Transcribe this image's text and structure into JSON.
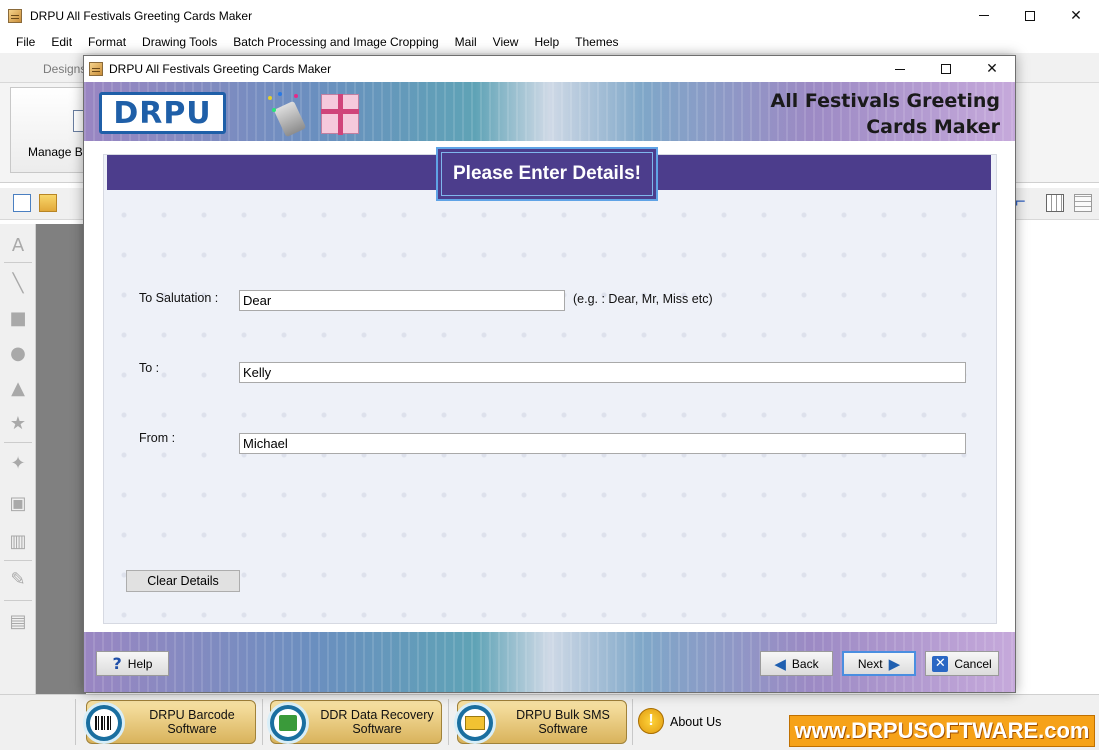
{
  "main_window": {
    "title": "DRPU All Festivals Greeting Cards Maker",
    "controls": {
      "minimize": "—",
      "maximize": "☐",
      "close": "✕"
    }
  },
  "menu": [
    "File",
    "Edit",
    "Format",
    "Drawing Tools",
    "Batch Processing and Image Cropping",
    "Mail",
    "View",
    "Help",
    "Themes"
  ],
  "ribbon": {
    "tab": "Designs",
    "button_label": "Manage Ba"
  },
  "dialog": {
    "title": "DRPU All Festivals Greeting Cards Maker",
    "controls": {
      "minimize": "—",
      "maximize": "☐",
      "close": "✕"
    },
    "banner": {
      "logo": "DRPU",
      "title_line1": "All Festivals Greeting",
      "title_line2": "Cards Maker"
    },
    "header": "Please Enter Details!",
    "fields": {
      "salutation": {
        "label": "To Salutation :",
        "value": "Dear",
        "hint": "(e.g. : Dear, Mr, Miss etc)"
      },
      "to": {
        "label": "To :",
        "value": "Kelly"
      },
      "from": {
        "label": "From :",
        "value": "Michael"
      }
    },
    "clear_button": "Clear Details",
    "footer": {
      "help": "Help",
      "back": "Back",
      "next": "Next",
      "cancel": "Cancel"
    }
  },
  "bottom_bar": {
    "promos": [
      {
        "line1": "DRPU Barcode",
        "line2": "Software",
        "icon": "barcode-icon"
      },
      {
        "line1": "DDR Data Recovery",
        "line2": "Software",
        "icon": "download-icon"
      },
      {
        "line1": "DRPU Bulk SMS",
        "line2": "Software",
        "icon": "mail-icon"
      }
    ],
    "about": "About Us",
    "url": "www.DRPUSOFTWARE.com"
  },
  "colors": {
    "header_strip": "#4c3d8c",
    "focus_border": "#4a8ee0",
    "brand_orange": "#f6a218",
    "logo_blue": "#1f5fa8"
  }
}
